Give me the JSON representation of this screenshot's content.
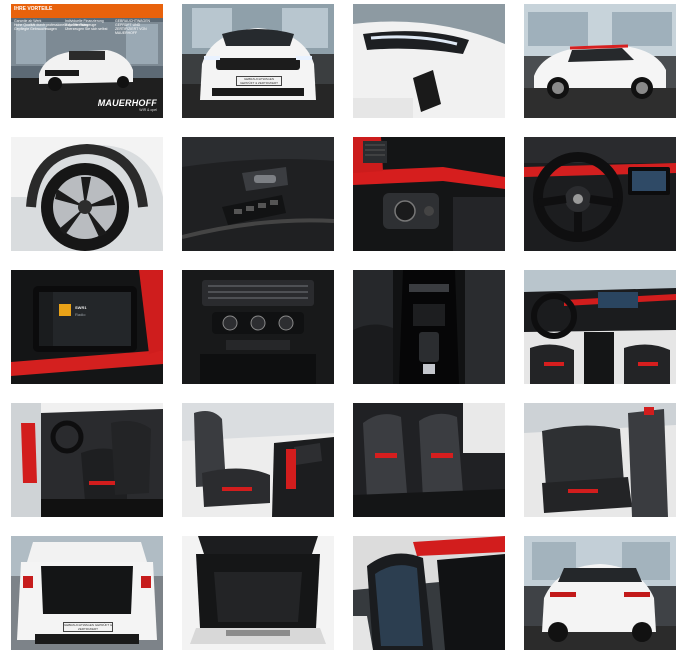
{
  "gallery": {
    "banner": {
      "title": "IHRE VORTEILE",
      "advantages": [
        "Garantie ab Werk",
        "Hohe Qualität durch professionelle Aufbereitung",
        "Gepflegte Gebrauchtwagen",
        "Individuelle Finanzierung",
        "Geprüfte Fahrzeuge",
        "Überzeugen Sie sich selbst"
      ],
      "certified": "GEBRAUCHTWAGEN GEPRÜFT UND ZERTIFIZIERT VON MAUERHOFF",
      "brand": "MAUERHOFF",
      "brand_sub": "WIR & opel"
    },
    "plate_text": "GEBRAUCHTWAGEN GEPRÜFT & ZERTIFIZIERT",
    "screen": {
      "label": "SWR1",
      "sub": "Radio"
    },
    "photos": [
      "exterior-front-showroom",
      "exterior-front",
      "headlight-detail",
      "exterior-side",
      "wheel-detail",
      "door-panel",
      "dashboard-lights-switch",
      "steering-wheel",
      "infotainment-screen",
      "center-console-controls",
      "center-tunnel",
      "interior-cockpit",
      "front-seats-open-door",
      "front-seats-side",
      "front-seats-rear-view",
      "rear-seats",
      "rear-open-trunk",
      "trunk-space",
      "door-sill",
      "exterior-rear"
    ]
  }
}
